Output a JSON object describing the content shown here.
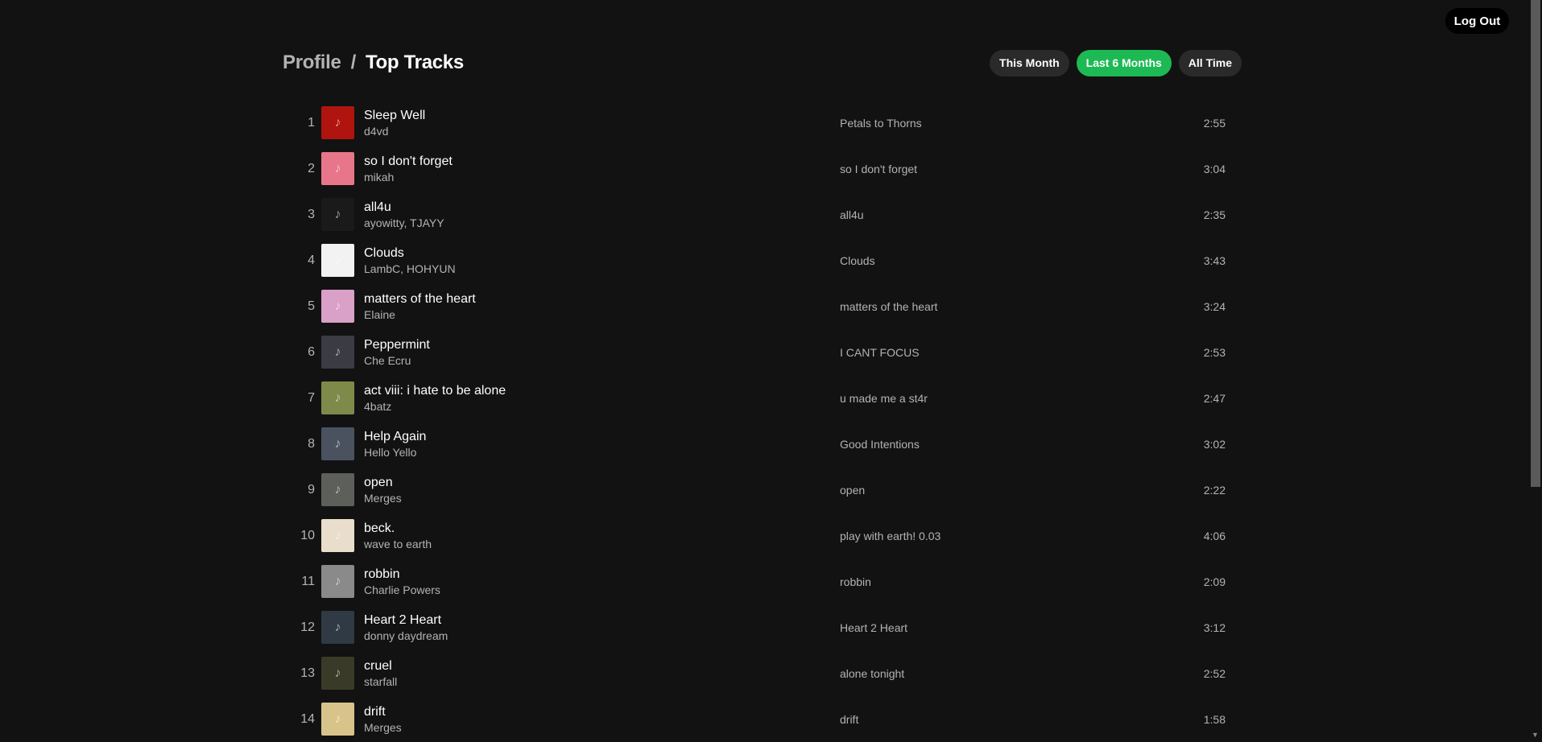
{
  "header": {
    "logout_label": "Log Out",
    "breadcrumb_root": "Profile",
    "breadcrumb_sep": "/",
    "breadcrumb_current": "Top Tracks"
  },
  "ranges": [
    {
      "label": "This Month",
      "active": false
    },
    {
      "label": "Last 6 Months",
      "active": true
    },
    {
      "label": "All Time",
      "active": false
    }
  ],
  "colors": {
    "accent": "#1db954",
    "background": "#121212",
    "secondary_text": "#b3b3b3"
  },
  "tracks": [
    {
      "rank": "1",
      "title": "Sleep Well",
      "artist": "d4vd",
      "album": "Petals to Thorns",
      "duration": "2:55",
      "art_color": "#b0140f",
      "art_icon": "music-note-icon"
    },
    {
      "rank": "2",
      "title": "so I don't forget",
      "artist": "mikah",
      "album": "so I don't forget",
      "duration": "3:04",
      "art_color": "#e8768a",
      "art_icon": "music-note-icon"
    },
    {
      "rank": "3",
      "title": "all4u",
      "artist": "ayowitty, TJAYY",
      "album": "all4u",
      "duration": "2:35",
      "art_color": "#1a1a1a",
      "art_icon": "music-note-icon"
    },
    {
      "rank": "4",
      "title": "Clouds",
      "artist": "LambC, HOHYUN",
      "album": "Clouds",
      "duration": "3:43",
      "art_color": "#f2f2f2",
      "art_icon": "music-note-icon"
    },
    {
      "rank": "5",
      "title": "matters of the heart",
      "artist": "Elaine",
      "album": "matters of the heart",
      "duration": "3:24",
      "art_color": "#d9a0c8",
      "art_icon": "music-note-icon"
    },
    {
      "rank": "6",
      "title": "Peppermint",
      "artist": "Che Ecru",
      "album": "I CANT FOCUS",
      "duration": "2:53",
      "art_color": "#3b3b44",
      "art_icon": "music-note-icon"
    },
    {
      "rank": "7",
      "title": "act viii: i hate to be alone",
      "artist": "4batz",
      "album": "u made me a st4r",
      "duration": "2:47",
      "art_color": "#7d8a4a",
      "art_icon": "music-note-icon"
    },
    {
      "rank": "8",
      "title": "Help Again",
      "artist": "Hello Yello",
      "album": "Good Intentions",
      "duration": "3:02",
      "art_color": "#4a5260",
      "art_icon": "music-note-icon"
    },
    {
      "rank": "9",
      "title": "open",
      "artist": "Merges",
      "album": "open",
      "duration": "2:22",
      "art_color": "#5d5f5a",
      "art_icon": "music-note-icon"
    },
    {
      "rank": "10",
      "title": "beck.",
      "artist": "wave to earth",
      "album": "play with earth! 0.03",
      "duration": "4:06",
      "art_color": "#e9ddcc",
      "art_icon": "music-note-icon"
    },
    {
      "rank": "11",
      "title": "robbin",
      "artist": "Charlie Powers",
      "album": "robbin",
      "duration": "2:09",
      "art_color": "#8a8a8a",
      "art_icon": "music-note-icon"
    },
    {
      "rank": "12",
      "title": "Heart 2 Heart",
      "artist": "donny daydream",
      "album": "Heart 2 Heart",
      "duration": "3:12",
      "art_color": "#2f3a44",
      "art_icon": "music-note-icon"
    },
    {
      "rank": "13",
      "title": "cruel",
      "artist": "starfall",
      "album": "alone tonight",
      "duration": "2:52",
      "art_color": "#3a3a28",
      "art_icon": "music-note-icon"
    },
    {
      "rank": "14",
      "title": "drift",
      "artist": "Merges",
      "album": "drift",
      "duration": "1:58",
      "art_color": "#d8c48a",
      "art_icon": "music-note-icon"
    }
  ]
}
